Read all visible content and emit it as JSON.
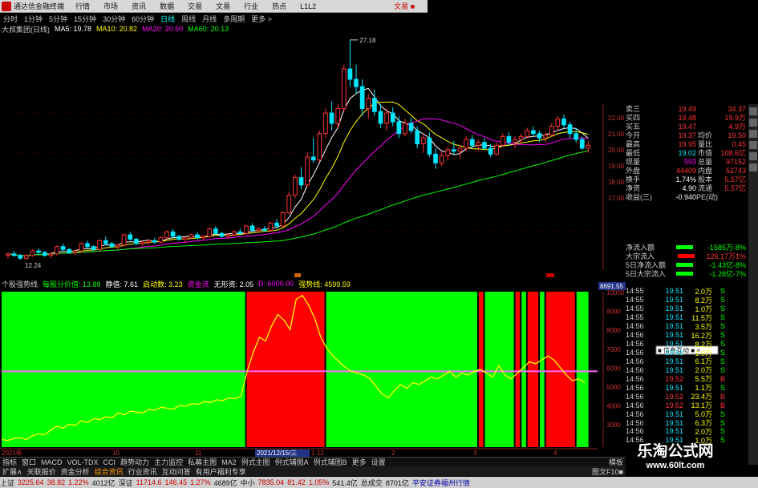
{
  "app": {
    "title": "通达信金融终端",
    "menu": [
      "行情",
      "市场",
      "资讯",
      "数据",
      "交易",
      "文易",
      "行业",
      "热点",
      "L1L2"
    ],
    "account": "文易 ■"
  },
  "periods": [
    {
      "label": "分时",
      "active": false
    },
    {
      "label": "1分钟",
      "active": false
    },
    {
      "label": "5分钟",
      "active": false
    },
    {
      "label": "15分钟",
      "active": false
    },
    {
      "label": "30分钟",
      "active": false
    },
    {
      "label": "60分钟",
      "active": false
    },
    {
      "label": "日线",
      "active": true
    },
    {
      "label": "周线",
      "active": false
    },
    {
      "label": "月线",
      "active": false
    },
    {
      "label": "多周期",
      "active": false
    },
    {
      "label": "更多 >",
      "active": false
    }
  ],
  "ma_legend": [
    {
      "text": "大叔集团(日线)",
      "color": "#cccccc"
    },
    {
      "text": "MA5: 19.78",
      "color": "#ffffff"
    },
    {
      "text": "MA10: 20.82",
      "color": "#ffff00"
    },
    {
      "text": "MA20: 20.50",
      "color": "#ff00ff"
    },
    {
      "text": "MA60: 20.13",
      "color": "#00ff00"
    }
  ],
  "indicator_legend": [
    {
      "text": "个股强势线",
      "color": "#cccccc"
    },
    {
      "text": "每股分价值: 13.89",
      "color": "#00ff00"
    },
    {
      "text": "静值: 7.61",
      "color": "#ffffff"
    },
    {
      "text": "启动数: 3.23",
      "color": "#ffff00"
    },
    {
      "text": "资金流",
      "color": "#ff00ff"
    },
    {
      "text": "无形资: 2.05",
      "color": "#ffffff"
    },
    {
      "text": "D: 6000.00",
      "color": "#ff00ff"
    },
    {
      "text": "强势线: 4599.59",
      "color": "#ffff00"
    }
  ],
  "colors": {
    "up": "#ff3333",
    "down": "#00e5ff",
    "bg": "#000000",
    "grid": "#550000",
    "green_zone": "#00ff00",
    "red_zone": "#ff0000"
  },
  "chart_data": {
    "type": "candlestick",
    "price_axis": {
      "ticks": [
        "22.00",
        "21.00",
        "20.00",
        "19.00",
        "18.00",
        "17.00"
      ],
      "range": [
        11.5,
        27.5
      ]
    },
    "high_label": "27.18",
    "low_label": "12.24",
    "date_axis": {
      "ticks": [
        "2021年",
        "10",
        "11",
        "12",
        "2021/12/15/三",
        "1",
        "2",
        "3",
        "4"
      ]
    },
    "candles": [
      [
        12.5,
        12.7,
        12.3,
        12.6
      ],
      [
        12.6,
        12.8,
        12.4,
        12.5
      ],
      [
        12.5,
        12.6,
        12.2,
        12.3
      ],
      [
        12.3,
        12.6,
        12.2,
        12.5
      ],
      [
        12.5,
        12.9,
        12.4,
        12.8
      ],
      [
        12.8,
        13.0,
        12.6,
        12.7
      ],
      [
        12.7,
        12.8,
        12.4,
        12.5
      ],
      [
        12.5,
        12.7,
        12.3,
        12.6
      ],
      [
        12.6,
        13.2,
        12.5,
        13.1
      ],
      [
        13.1,
        13.3,
        12.8,
        12.9
      ],
      [
        12.9,
        13.0,
        12.6,
        12.7
      ],
      [
        12.7,
        12.9,
        12.5,
        12.8
      ],
      [
        12.8,
        13.4,
        12.7,
        13.3
      ],
      [
        13.3,
        13.5,
        13.0,
        13.1
      ],
      [
        13.1,
        13.2,
        12.8,
        12.9
      ],
      [
        12.9,
        13.6,
        12.8,
        13.5
      ],
      [
        13.5,
        13.8,
        13.2,
        13.3
      ],
      [
        13.3,
        13.4,
        13.0,
        13.1
      ],
      [
        13.1,
        13.3,
        12.9,
        13.2
      ],
      [
        13.2,
        14.0,
        13.1,
        13.9
      ],
      [
        13.9,
        14.1,
        13.5,
        13.6
      ],
      [
        13.6,
        13.7,
        13.2,
        13.3
      ],
      [
        13.3,
        13.5,
        13.1,
        13.4
      ],
      [
        13.4,
        13.6,
        13.2,
        13.5
      ],
      [
        13.5,
        13.7,
        13.3,
        13.4
      ],
      [
        13.4,
        13.8,
        13.3,
        13.7
      ],
      [
        13.7,
        14.2,
        13.6,
        14.1
      ],
      [
        14.1,
        14.3,
        13.7,
        13.8
      ],
      [
        13.8,
        13.9,
        13.5,
        13.6
      ],
      [
        13.6,
        13.8,
        13.4,
        13.7
      ],
      [
        13.7,
        14.0,
        13.6,
        13.9
      ],
      [
        13.9,
        14.1,
        13.6,
        13.7
      ],
      [
        13.7,
        13.9,
        13.5,
        13.8
      ],
      [
        13.8,
        14.4,
        13.7,
        14.3
      ],
      [
        14.3,
        14.5,
        13.9,
        14.0
      ],
      [
        14.0,
        14.1,
        13.7,
        13.8
      ],
      [
        13.8,
        14.0,
        13.6,
        13.9
      ],
      [
        13.9,
        14.2,
        13.8,
        14.1
      ],
      [
        14.1,
        14.3,
        13.9,
        14.0
      ],
      [
        14.0,
        14.6,
        13.9,
        14.5
      ],
      [
        14.5,
        14.7,
        14.1,
        14.2
      ],
      [
        14.2,
        14.4,
        14.0,
        14.3
      ],
      [
        14.3,
        14.5,
        14.1,
        14.2
      ],
      [
        14.2,
        14.8,
        14.1,
        14.7
      ],
      [
        14.7,
        15.0,
        14.4,
        14.5
      ],
      [
        14.5,
        15.5,
        14.4,
        15.4
      ],
      [
        15.4,
        16.8,
        15.3,
        16.6
      ],
      [
        16.6,
        18.0,
        16.4,
        17.8
      ],
      [
        17.8,
        18.5,
        17.0,
        17.3
      ],
      [
        17.3,
        19.5,
        17.2,
        19.2
      ],
      [
        19.2,
        20.5,
        18.8,
        19.0
      ],
      [
        19.0,
        21.0,
        18.9,
        20.8
      ],
      [
        20.8,
        22.5,
        20.5,
        22.2
      ],
      [
        22.2,
        23.0,
        21.0,
        21.5
      ],
      [
        21.5,
        22.8,
        21.2,
        22.5
      ],
      [
        22.5,
        25.5,
        22.3,
        25.2
      ],
      [
        25.2,
        27.18,
        24.0,
        24.5
      ],
      [
        24.5,
        25.5,
        23.5,
        24.0
      ],
      [
        24.0,
        24.5,
        22.0,
        22.5
      ],
      [
        22.5,
        23.5,
        21.8,
        23.2
      ],
      [
        23.2,
        23.8,
        22.0,
        22.3
      ],
      [
        22.3,
        22.8,
        21.2,
        21.5
      ],
      [
        21.5,
        22.5,
        21.0,
        22.2
      ],
      [
        22.2,
        22.6,
        21.3,
        21.6
      ],
      [
        21.6,
        22.0,
        20.5,
        20.8
      ],
      [
        20.8,
        21.8,
        20.6,
        21.5
      ],
      [
        21.5,
        21.9,
        20.8,
        21.0
      ],
      [
        21.0,
        21.3,
        19.8,
        20.1
      ],
      [
        20.1,
        20.8,
        19.5,
        20.5
      ],
      [
        20.5,
        20.9,
        19.2,
        19.4
      ],
      [
        19.4,
        19.8,
        18.4,
        18.8
      ],
      [
        18.8,
        19.6,
        18.6,
        19.3
      ],
      [
        19.3,
        19.9,
        19.0,
        19.7
      ],
      [
        19.7,
        20.3,
        19.4,
        19.6
      ],
      [
        19.6,
        20.0,
        19.1,
        19.8
      ],
      [
        19.8,
        20.6,
        19.6,
        20.4
      ],
      [
        20.4,
        20.7,
        19.8,
        20.0
      ],
      [
        20.0,
        20.4,
        19.6,
        20.2
      ],
      [
        20.2,
        20.5,
        19.7,
        19.8
      ],
      [
        19.8,
        20.1,
        19.2,
        19.4
      ],
      [
        19.4,
        20.2,
        19.3,
        20.0
      ],
      [
        20.0,
        20.8,
        19.9,
        20.6
      ],
      [
        20.6,
        20.9,
        20.0,
        20.2
      ],
      [
        20.2,
        20.6,
        19.8,
        20.4
      ],
      [
        20.4,
        20.8,
        20.1,
        20.6
      ],
      [
        20.6,
        21.2,
        20.5,
        21.0
      ],
      [
        21.0,
        21.3,
        20.6,
        20.8
      ],
      [
        20.8,
        21.0,
        20.2,
        20.5
      ],
      [
        20.5,
        20.9,
        20.2,
        20.7
      ],
      [
        20.7,
        21.5,
        20.6,
        21.3
      ],
      [
        21.3,
        22.0,
        21.0,
        21.8
      ],
      [
        21.8,
        22.1,
        21.2,
        21.4
      ],
      [
        21.4,
        21.6,
        20.5,
        20.8
      ],
      [
        20.8,
        21.2,
        20.2,
        20.4
      ],
      [
        20.4,
        20.6,
        19.7,
        19.8
      ],
      [
        19.8,
        20.3,
        19.5,
        20.0
      ]
    ],
    "indicator": {
      "line_values": [
        2400,
        2350,
        2450,
        2500,
        2400,
        2600,
        2700,
        2650,
        2900,
        3100,
        3000,
        3200,
        3150,
        3400,
        3300,
        3500,
        3450,
        3600,
        3550,
        3800,
        3700,
        3900,
        3850,
        3800,
        4000,
        3950,
        4100,
        4050,
        4000,
        4200,
        4150,
        4300,
        4250,
        4400,
        4350,
        4500,
        4450,
        4600,
        4550,
        4700,
        6000,
        7000,
        7800,
        7600,
        8400,
        9000,
        8700,
        8200,
        9800,
        10000,
        9500,
        8800,
        7800,
        7200,
        6800,
        6500,
        6200,
        6000,
        5900,
        5800,
        5600,
        5200,
        4800,
        4600,
        5000,
        5300,
        5100,
        5400,
        5300,
        5500,
        5700,
        5600,
        5800,
        6000,
        5700,
        5900,
        5800,
        6000,
        6100,
        5900,
        5700,
        6300,
        5800,
        5600,
        5900,
        6200,
        6500,
        6400,
        6600,
        6800,
        6600,
        6200,
        5800,
        5500,
        5600,
        5400
      ],
      "ref_level": 6000,
      "y_ticks": [
        "10000",
        "9000",
        "8000",
        "7000",
        "6000",
        "5000",
        "4000",
        "3000"
      ],
      "current_label": "8691.55",
      "zones": [
        "g",
        "g",
        "g",
        "g",
        "g",
        "g",
        "g",
        "g",
        "g",
        "g",
        "g",
        "g",
        "g",
        "g",
        "g",
        "g",
        "g",
        "g",
        "g",
        "g",
        "g",
        "g",
        "g",
        "g",
        "g",
        "g",
        "g",
        "g",
        "g",
        "g",
        "g",
        "g",
        "g",
        "g",
        "g",
        "g",
        "g",
        "g",
        "g",
        "g",
        "r",
        "r",
        "r",
        "r",
        "r",
        "r",
        "r",
        "r",
        "r",
        "r",
        "r",
        "r",
        "r",
        "g",
        "g",
        "g",
        "g",
        "g",
        "g",
        "g",
        "g",
        "g",
        "g",
        "g",
        "g",
        "g",
        "g",
        "g",
        "g",
        "g",
        "g",
        "g",
        "g",
        "g",
        "g",
        "g",
        "g",
        "g",
        "r",
        "g",
        "g",
        "g",
        "g",
        "g",
        "r",
        "g",
        "r",
        "r",
        "g",
        "r",
        "r",
        "r",
        "r",
        "r",
        "g",
        "g"
      ]
    }
  },
  "quote": {
    "rows": [
      {
        "l": "卖三",
        "p": "19.49",
        "m": "",
        "v": "34.37",
        "pc": "#ff3333"
      },
      {
        "l": "买四",
        "p": "19.48",
        "m": "",
        "v": "19.9万",
        "pc": "#ff3333"
      },
      {
        "l": "买五",
        "p": "19.47",
        "m": "",
        "v": "4.9万",
        "pc": "#ff3333"
      },
      {
        "l": "今开",
        "p": "19.37",
        "m": "均价",
        "v": "19.50",
        "pc": "#ff3333"
      },
      {
        "l": "最高",
        "p": "19.95",
        "m": "量比",
        "v": "0.45",
        "pc": "#ff3333"
      },
      {
        "l": "最低",
        "p": "19.02",
        "m": "市值",
        "v": "108.6亿",
        "pc": "#00e5ff"
      },
      {
        "l": "现量",
        "p": "593",
        "m": "总量",
        "v": "97152",
        "pc": "#ff00ff"
      },
      {
        "l": "外盘",
        "p": "44409",
        "m": "内盘",
        "v": "52743",
        "pc": "#ff3333"
      },
      {
        "l": "换手",
        "p": "1.74%",
        "m": "股本",
        "v": "5.57亿",
        "pc": "#ffffff"
      },
      {
        "l": "净资",
        "p": "4.90",
        "m": "流通",
        "v": "5.57亿",
        "pc": "#ffffff"
      },
      {
        "l": "收益(三)",
        "p": "-0.940",
        "m": "PE(动)",
        "v": "",
        "pc": "#ffffff"
      }
    ],
    "flows": [
      {
        "label": "净流入额",
        "bar": "#00ff00",
        "value": "-1585万",
        "extra": "-8%",
        "vc": "#00ff00"
      },
      {
        "label": "大宗流入",
        "bar": "#ff0000",
        "value": "126.17万",
        "extra": "1%",
        "vc": "#ff3333"
      },
      {
        "label": "5日净流入额",
        "bar": "#00ff00",
        "value": "-1.43亿",
        "extra": "-8%",
        "vc": "#00ff00"
      },
      {
        "label": "5日大宗流入",
        "bar": "#00ff00",
        "value": "-1.28亿",
        "extra": "-7%",
        "vc": "#00ff00"
      }
    ],
    "ticks": [
      {
        "t": "14:55",
        "p": "19.51",
        "v": "2.0万",
        "s": "S",
        "sc": "#00ff00"
      },
      {
        "t": "14:55",
        "p": "19.51",
        "v": "8.2万",
        "s": "S",
        "sc": "#00ff00"
      },
      {
        "t": "14:55",
        "p": "19.51",
        "v": "1.0万",
        "s": "S",
        "sc": "#00ff00"
      },
      {
        "t": "14:55",
        "p": "19.51",
        "v": "11.5万",
        "s": "S",
        "sc": "#00ff00"
      },
      {
        "t": "14:56",
        "p": "19.51",
        "v": "3.5万",
        "s": "S",
        "sc": "#00ff00"
      },
      {
        "t": "14:56",
        "p": "19.51",
        "v": "16.2万",
        "s": "S",
        "sc": "#00ff00"
      },
      {
        "t": "14:56",
        "p": "19.51",
        "v": "8.2万",
        "s": "S",
        "sc": "#00ff00"
      },
      {
        "t": "14:56",
        "p": "19.51",
        "v": "1.0万",
        "s": "S",
        "sc": "#00ff00"
      },
      {
        "t": "14:56",
        "p": "19.51",
        "v": "6.1万",
        "s": "S",
        "sc": "#00ff00"
      },
      {
        "t": "14:56",
        "p": "19.51",
        "v": "2.0万",
        "s": "S",
        "sc": "#00ff00"
      },
      {
        "t": "14:56",
        "p": "19.52",
        "v": "5.5万",
        "s": "B",
        "sc": "#ff3333"
      },
      {
        "t": "14:56",
        "p": "19.51",
        "v": "1.1万",
        "s": "S",
        "sc": "#00ff00"
      },
      {
        "t": "14:56",
        "p": "19.52",
        "v": "23.4万",
        "s": "B",
        "sc": "#ff3333"
      },
      {
        "t": "14:56",
        "p": "19.52",
        "v": "13.1万",
        "s": "B",
        "sc": "#ff3333"
      },
      {
        "t": "14:56",
        "p": "19.51",
        "v": "5.0万",
        "s": "S",
        "sc": "#00ff00"
      },
      {
        "t": "14:56",
        "p": "19.51",
        "v": "6.3万",
        "s": "S",
        "sc": "#00ff00"
      },
      {
        "t": "14:56",
        "p": "19.51",
        "v": "2.0万",
        "s": "S",
        "sc": "#00ff00"
      },
      {
        "t": "14:56",
        "p": "19.51",
        "v": "1.0万",
        "s": "S",
        "sc": "#00ff00"
      }
    ]
  },
  "popup_label": "■ 信息互动 ■ ×",
  "tabs_row1": [
    "指标",
    "窗口",
    "MACD",
    "VOL-TDX",
    "CCI",
    "趋势动力",
    "主力监控",
    "私募主图",
    "MA2",
    "例式主图",
    "例式辅图A",
    "例式辅图B",
    "更多",
    "设置"
  ],
  "tabs_row2": [
    {
      "label": "扩展∧",
      "orange": false
    },
    {
      "label": "关联报价",
      "orange": false
    },
    {
      "label": "资金分析",
      "orange": false
    },
    {
      "label": "综合资讯",
      "orange": true
    },
    {
      "label": "行业资讯",
      "orange": false
    },
    {
      "label": "互动问答",
      "orange": false
    },
    {
      "label": "有用户福利专享",
      "orange": false
    }
  ],
  "tabs_right": [
    "图文F10■",
    "模板"
  ],
  "statusbar": {
    "sh_label": "上证",
    "sh_value": "3225.64",
    "sh_change": "38.82",
    "sh_pct": "1.22%",
    "sh_vol": "4012亿",
    "sz_label": "深证",
    "sz_value": "11714.6",
    "sz_change": "146.45",
    "sz_pct": "1.27%",
    "sz_vol": "4689亿",
    "zx_label": "中小",
    "zx_value": "7835.04",
    "zx_change": "81.42",
    "zx_pct": "1.05%",
    "zx_vol": "541.4亿",
    "total_label": "总成交",
    "total_value": "8701亿",
    "broker": "平安证券福州行情"
  },
  "watermark": {
    "line1": "乐淘公式网",
    "line2": "www.60lt.com"
  }
}
